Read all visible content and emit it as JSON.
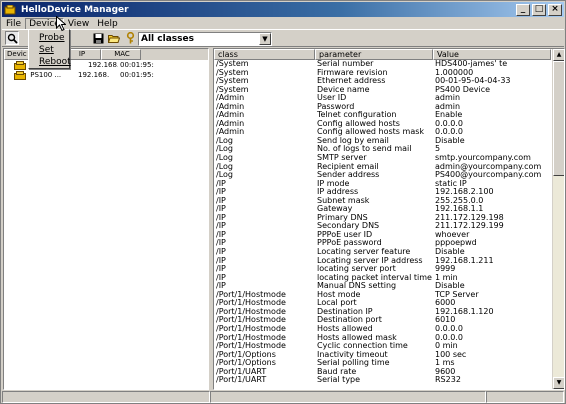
{
  "window": {
    "title": "HelloDevice Manager",
    "controls": {
      "minimize": "_",
      "maximize": "□",
      "close": "×"
    }
  },
  "menu": [
    {
      "label": "File"
    },
    {
      "label": "Device",
      "active": true
    },
    {
      "label": "View"
    },
    {
      "label": "Help"
    }
  ],
  "device_menu": [
    {
      "label": "Probe"
    },
    {
      "label": "Set"
    },
    {
      "label": "Reboot"
    }
  ],
  "toolbar": {
    "icons": [
      "search-icon",
      "save-icon",
      "open-folder-icon",
      "key-icon"
    ],
    "filter_value": "All classes",
    "filter_arrow": "▼"
  },
  "device_list": {
    "headers": [
      "Devic",
      "IP",
      "MAC"
    ],
    "rows": [
      {
        "name": "",
        "ip": "192.168.",
        "mac": "00:01:95:"
      },
      {
        "name": "PS100 ...",
        "ip": "192.168.",
        "mac": "00:01:95:"
      }
    ]
  },
  "param_table": {
    "headers": [
      "class",
      "parameter",
      "Value"
    ],
    "rows": [
      [
        "/System",
        "Serial number",
        "HDS400-james' te"
      ],
      [
        "/System",
        "Firmware revision",
        "1.000000"
      ],
      [
        "/System",
        "Ethernet address",
        "00-01-95-04-04-33"
      ],
      [
        "/System",
        "Device name",
        "PS400 Device"
      ],
      [
        "/Admin",
        "User ID",
        "admin"
      ],
      [
        "/Admin",
        "Password",
        "admin"
      ],
      [
        "/Admin",
        "Telnet configuration",
        "Enable"
      ],
      [
        "/Admin",
        "Config allowed hosts",
        "0.0.0.0"
      ],
      [
        "/Admin",
        "Config allowed hosts mask",
        "0.0.0.0"
      ],
      [
        "/Log",
        "Send log by email",
        "Disable"
      ],
      [
        "/Log",
        "No. of logs to send mail",
        "5"
      ],
      [
        "/Log",
        "SMTP server",
        "smtp.yourcompany.com"
      ],
      [
        "/Log",
        "Recipient email",
        "admin@yourcompany.com"
      ],
      [
        "/Log",
        "Sender address",
        "PS400@yourcompany.com"
      ],
      [
        "/IP",
        "IP mode",
        "static IP"
      ],
      [
        "/IP",
        "IP address",
        "192.168.2.100"
      ],
      [
        "/IP",
        "Subnet mask",
        "255.255.0.0"
      ],
      [
        "/IP",
        "Gateway",
        "192.168.1.1"
      ],
      [
        "/IP",
        "Primary DNS",
        "211.172.129.198"
      ],
      [
        "/IP",
        "Secondary DNS",
        "211.172.129.199"
      ],
      [
        "/IP",
        "PPPoE user ID",
        "whoever"
      ],
      [
        "/IP",
        "PPPoE password",
        "pppoepwd"
      ],
      [
        "/IP",
        "Locating server feature",
        "Disable"
      ],
      [
        "/IP",
        "Locating server IP address",
        "192.168.1.211"
      ],
      [
        "/IP",
        "locating server port",
        "9999"
      ],
      [
        "/IP",
        "locating packet interval time",
        "1 min"
      ],
      [
        "/IP",
        "Manual DNS setting",
        "Disable"
      ],
      [
        "/Port/1/Hostmode",
        "Host mode",
        "TCP Server"
      ],
      [
        "/Port/1/Hostmode",
        "Local port",
        "6000"
      ],
      [
        "/Port/1/Hostmode",
        "Destination IP",
        "192.168.1.120"
      ],
      [
        "/Port/1/Hostmode",
        "Destination port",
        "6010"
      ],
      [
        "/Port/1/Hostmode",
        "Hosts allowed",
        "0.0.0.0"
      ],
      [
        "/Port/1/Hostmode",
        "Hosts allowed mask",
        "0.0.0.0"
      ],
      [
        "/Port/1/Hostmode",
        "Cyclic connection time",
        "0 min"
      ],
      [
        "/Port/1/Options",
        "Inactivity timeout",
        "100 sec"
      ],
      [
        "/Port/1/Options",
        "Serial polling time",
        "1 ms"
      ],
      [
        "/Port/1/UART",
        "Baud rate",
        "9600"
      ],
      [
        "/Port/1/UART",
        "Serial type",
        "RS232"
      ]
    ]
  },
  "scrollbar": {
    "up": "▲",
    "down": "▼"
  }
}
